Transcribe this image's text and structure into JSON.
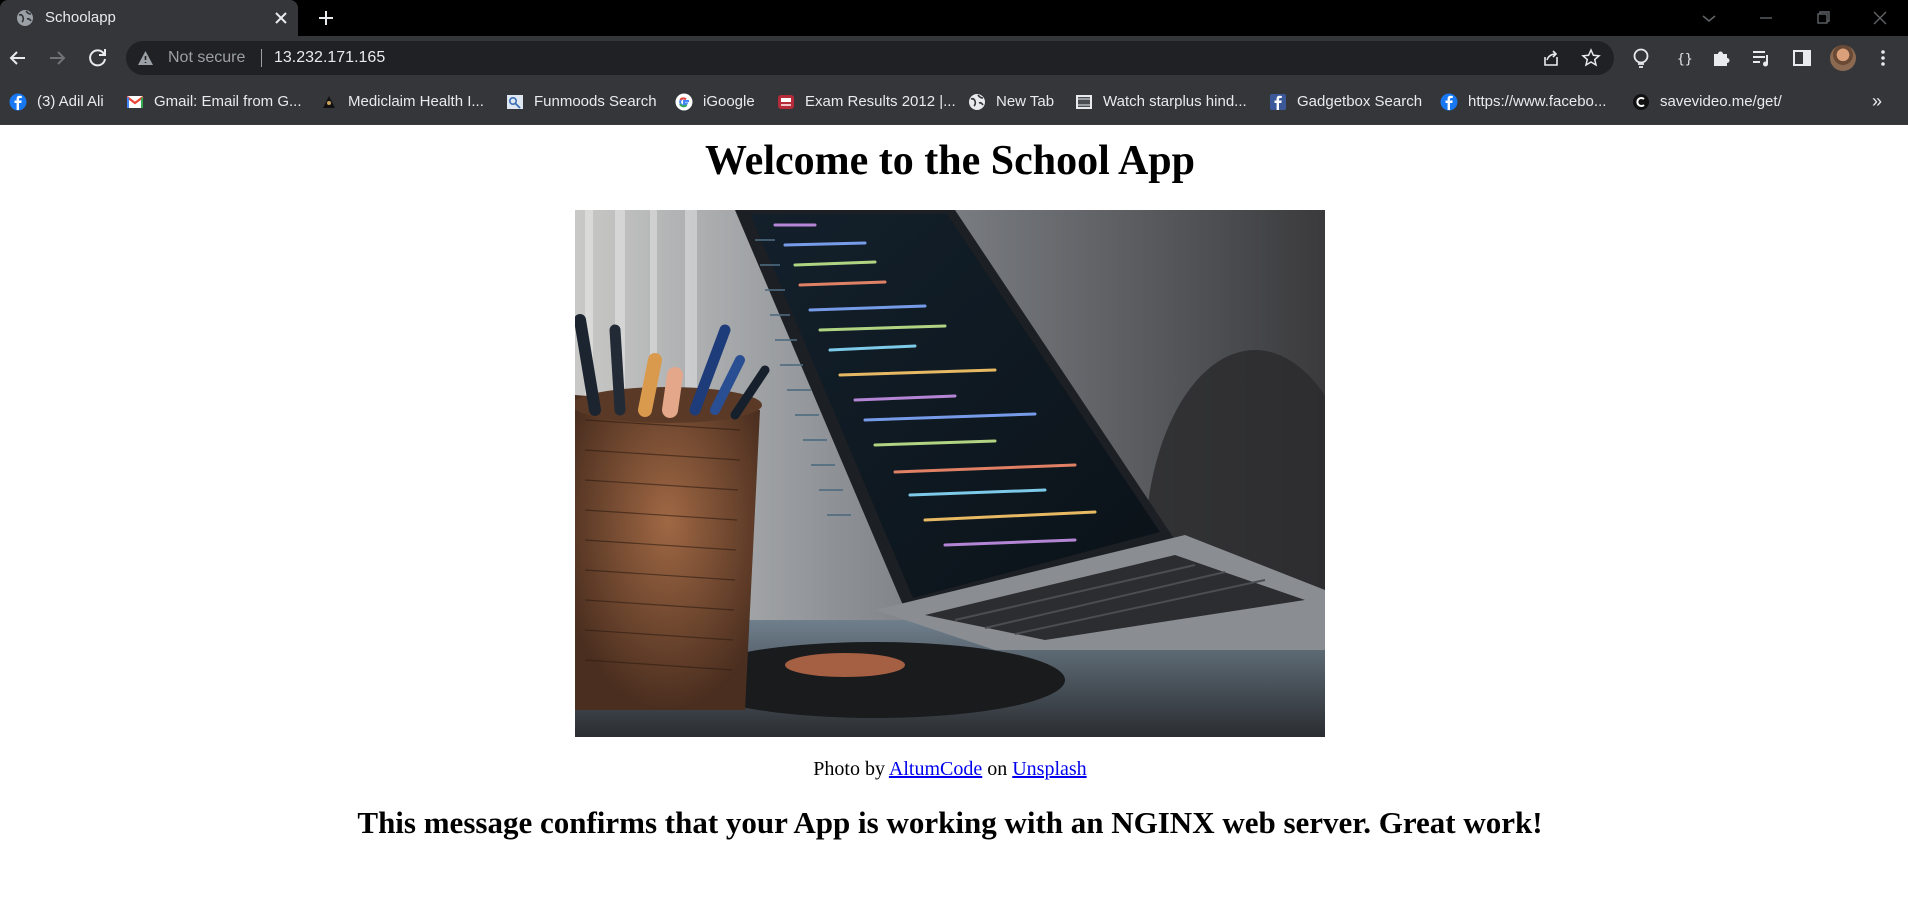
{
  "browser": {
    "tab": {
      "title": "Schoolapp",
      "favicon": "globe-icon",
      "active": true
    },
    "address_bar": {
      "security_label": "Not secure",
      "security_icon": "warning-icon",
      "url": "13.232.171.165"
    },
    "bookmarks": [
      {
        "label": "(3) Adil Ali",
        "icon": "facebook-icon"
      },
      {
        "label": "Gmail: Email from G...",
        "icon": "gmail-icon"
      },
      {
        "label": "Mediclaim Health I...",
        "icon": "mediclaim-icon"
      },
      {
        "label": "Funmoods Search",
        "icon": "funmoods-icon"
      },
      {
        "label": "iGoogle",
        "icon": "google-icon"
      },
      {
        "label": "Exam Results 2012 |...",
        "icon": "exam-results-icon"
      },
      {
        "label": "New Tab",
        "icon": "globe-icon"
      },
      {
        "label": "Watch starplus hind...",
        "icon": "film-icon"
      },
      {
        "label": "Gadgetbox Search",
        "icon": "facebook-square-icon"
      },
      {
        "label": "https://www.facebo...",
        "icon": "facebook-icon"
      },
      {
        "label": "savevideo.me/get/",
        "icon": "savevideo-icon"
      }
    ],
    "bookmarks_overflow": "»",
    "colors": {
      "tabstrip": "#000000",
      "toolbar": "#35363a",
      "omnibox": "#202124",
      "text": "#e8eaed",
      "muted": "#9aa0a6"
    }
  },
  "page": {
    "heading": "Welcome to the School App",
    "image_subject": "laptop displaying code next to a pencil cup",
    "caption": {
      "prefix": "Photo by",
      "author": "AltumCode",
      "middle": "on",
      "source": "Unsplash"
    },
    "message": "This message confirms that your App is working with an NGINX web server. Great work!",
    "colors": {
      "link": "#0000ee",
      "text": "#000000",
      "background": "#ffffff"
    }
  }
}
